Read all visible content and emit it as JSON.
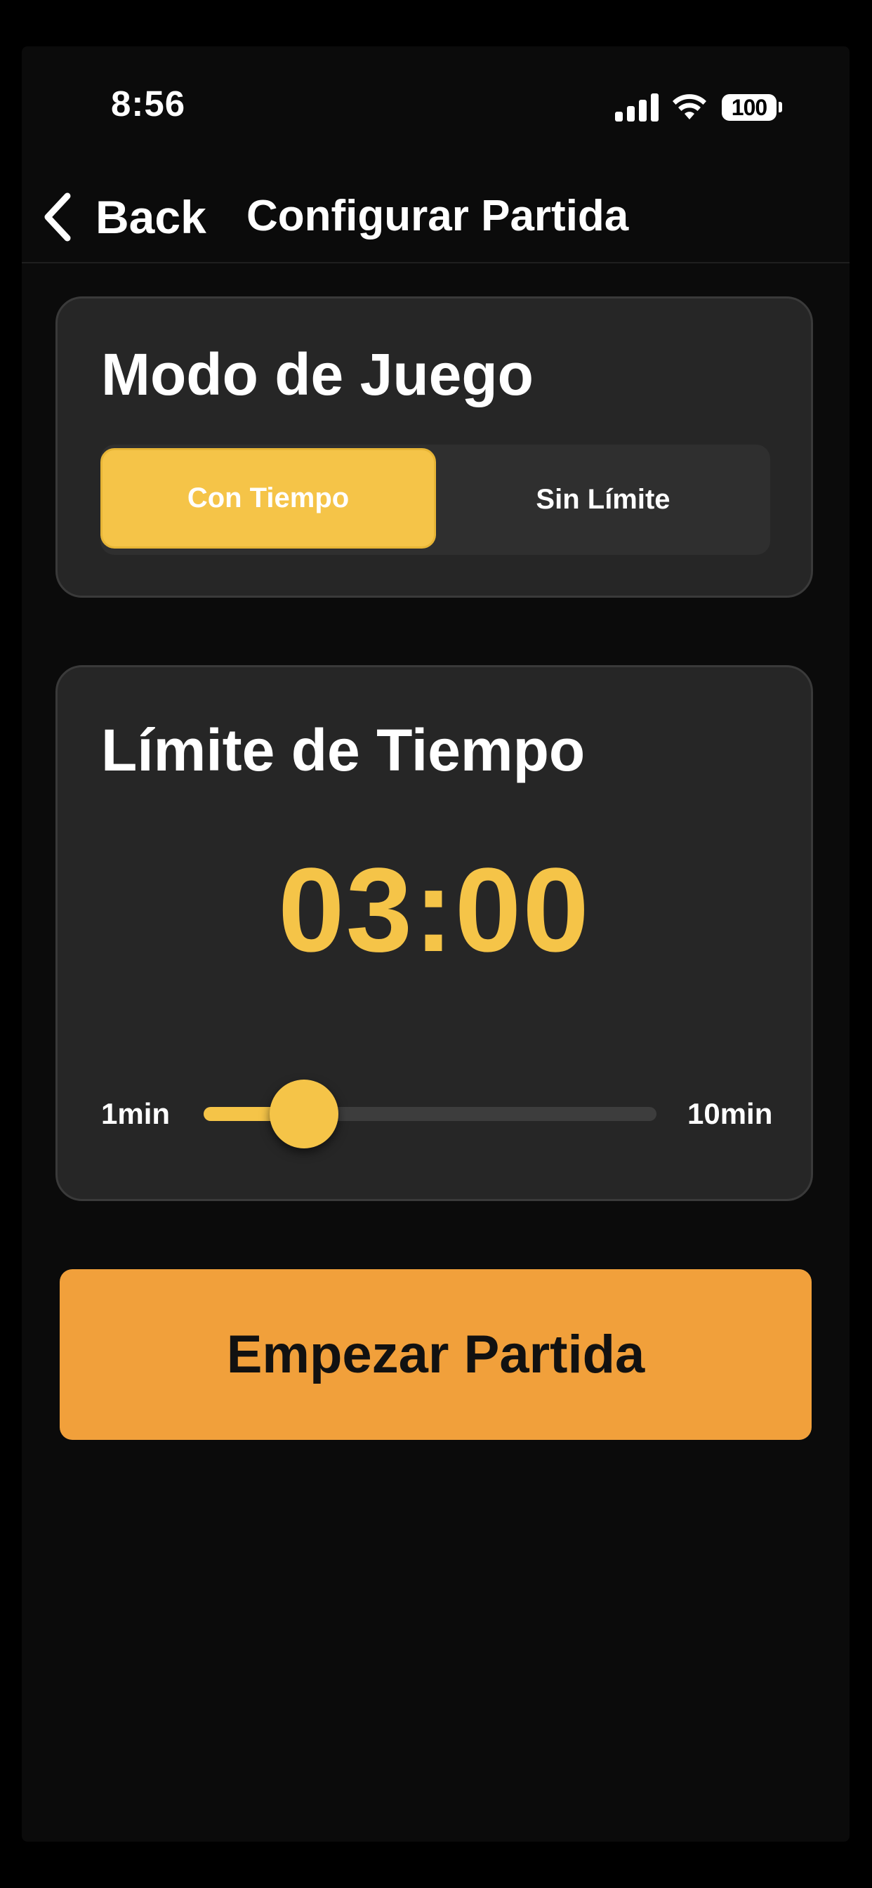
{
  "status_bar": {
    "time": "8:56",
    "battery": "100",
    "icons": [
      "signal-icon",
      "wifi-icon",
      "battery-icon"
    ]
  },
  "nav": {
    "back_label": "Back",
    "title": "Configurar Partida",
    "icons": [
      "chevron-left-icon"
    ]
  },
  "mode_card": {
    "title": "Modo de Juego",
    "options": [
      {
        "label": "Con Tiempo",
        "selected": true
      },
      {
        "label": "Sin Límite",
        "selected": false
      }
    ]
  },
  "time_card": {
    "title": "Límite de Tiempo",
    "value": "03:00",
    "slider": {
      "min_label": "1min",
      "max_label": "10min",
      "min": 1,
      "max": 10,
      "current": 3
    }
  },
  "start_button": {
    "label": "Empezar Partida"
  },
  "colors": {
    "accent": "#f5c448",
    "start": "#f1a03b",
    "card": "#262626",
    "background": "#0b0b0b"
  }
}
